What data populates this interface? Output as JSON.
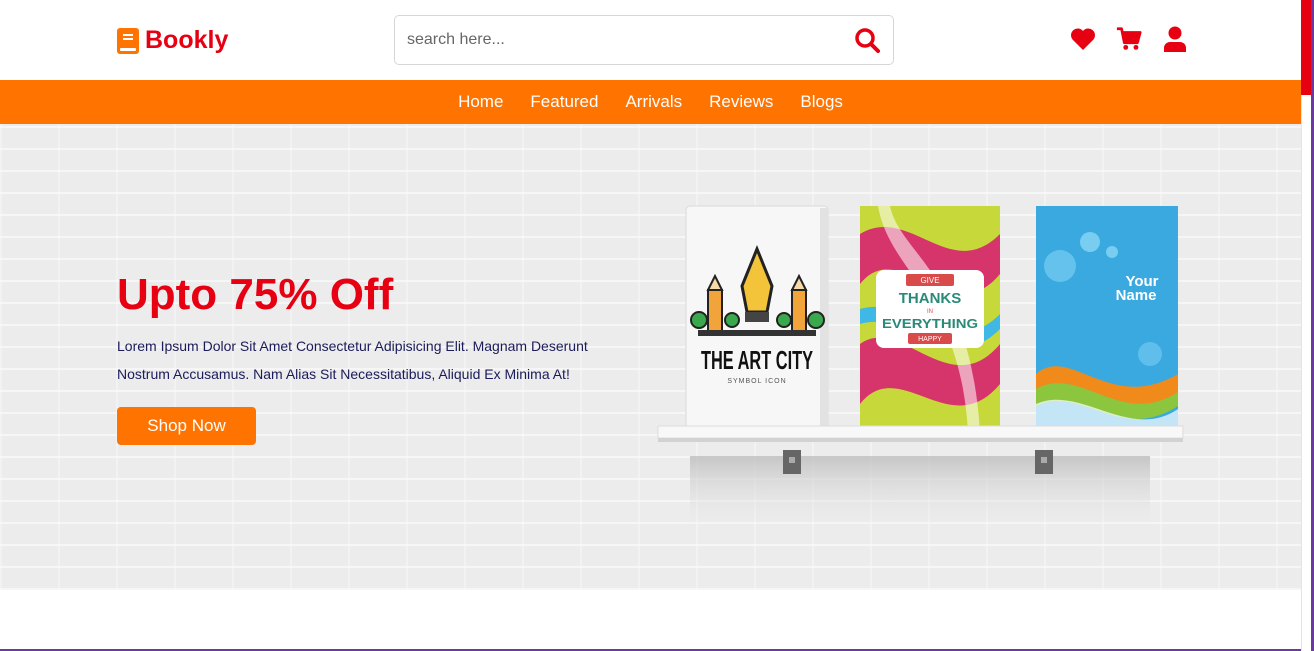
{
  "brand": {
    "name": "Bookly"
  },
  "search": {
    "placeholder": "search here..."
  },
  "nav": {
    "items": [
      {
        "label": "Home"
      },
      {
        "label": "Featured"
      },
      {
        "label": "Arrivals"
      },
      {
        "label": "Reviews"
      },
      {
        "label": "Blogs"
      }
    ]
  },
  "hero": {
    "title": "Upto 75% Off",
    "description": "Lorem Ipsum Dolor Sit Amet Consectetur Adipisicing Elit. Magnam Deserunt Nostrum Accusamus. Nam Alias Sit Necessitatibus, Aliquid Ex Minima At!",
    "button_label": "Shop Now"
  },
  "books": [
    {
      "line1": "THE ART CITY",
      "line2": "SYMBOL ICON"
    },
    {
      "line1": "GIVE",
      "line2": "THANKS",
      "line3": "IN",
      "line4": "EVERYTHING",
      "line5": "HAPPY"
    },
    {
      "line1": "Your",
      "line2": "Name"
    }
  ],
  "icons": {
    "logo": "book-icon",
    "search": "search-icon",
    "wishlist": "heart-icon",
    "cart": "cart-icon",
    "account": "user-icon"
  },
  "colors": {
    "accent": "#ff7300",
    "brand_red": "#e60012",
    "hero_bg": "#ececec",
    "text_dark": "#1b1b5a"
  }
}
